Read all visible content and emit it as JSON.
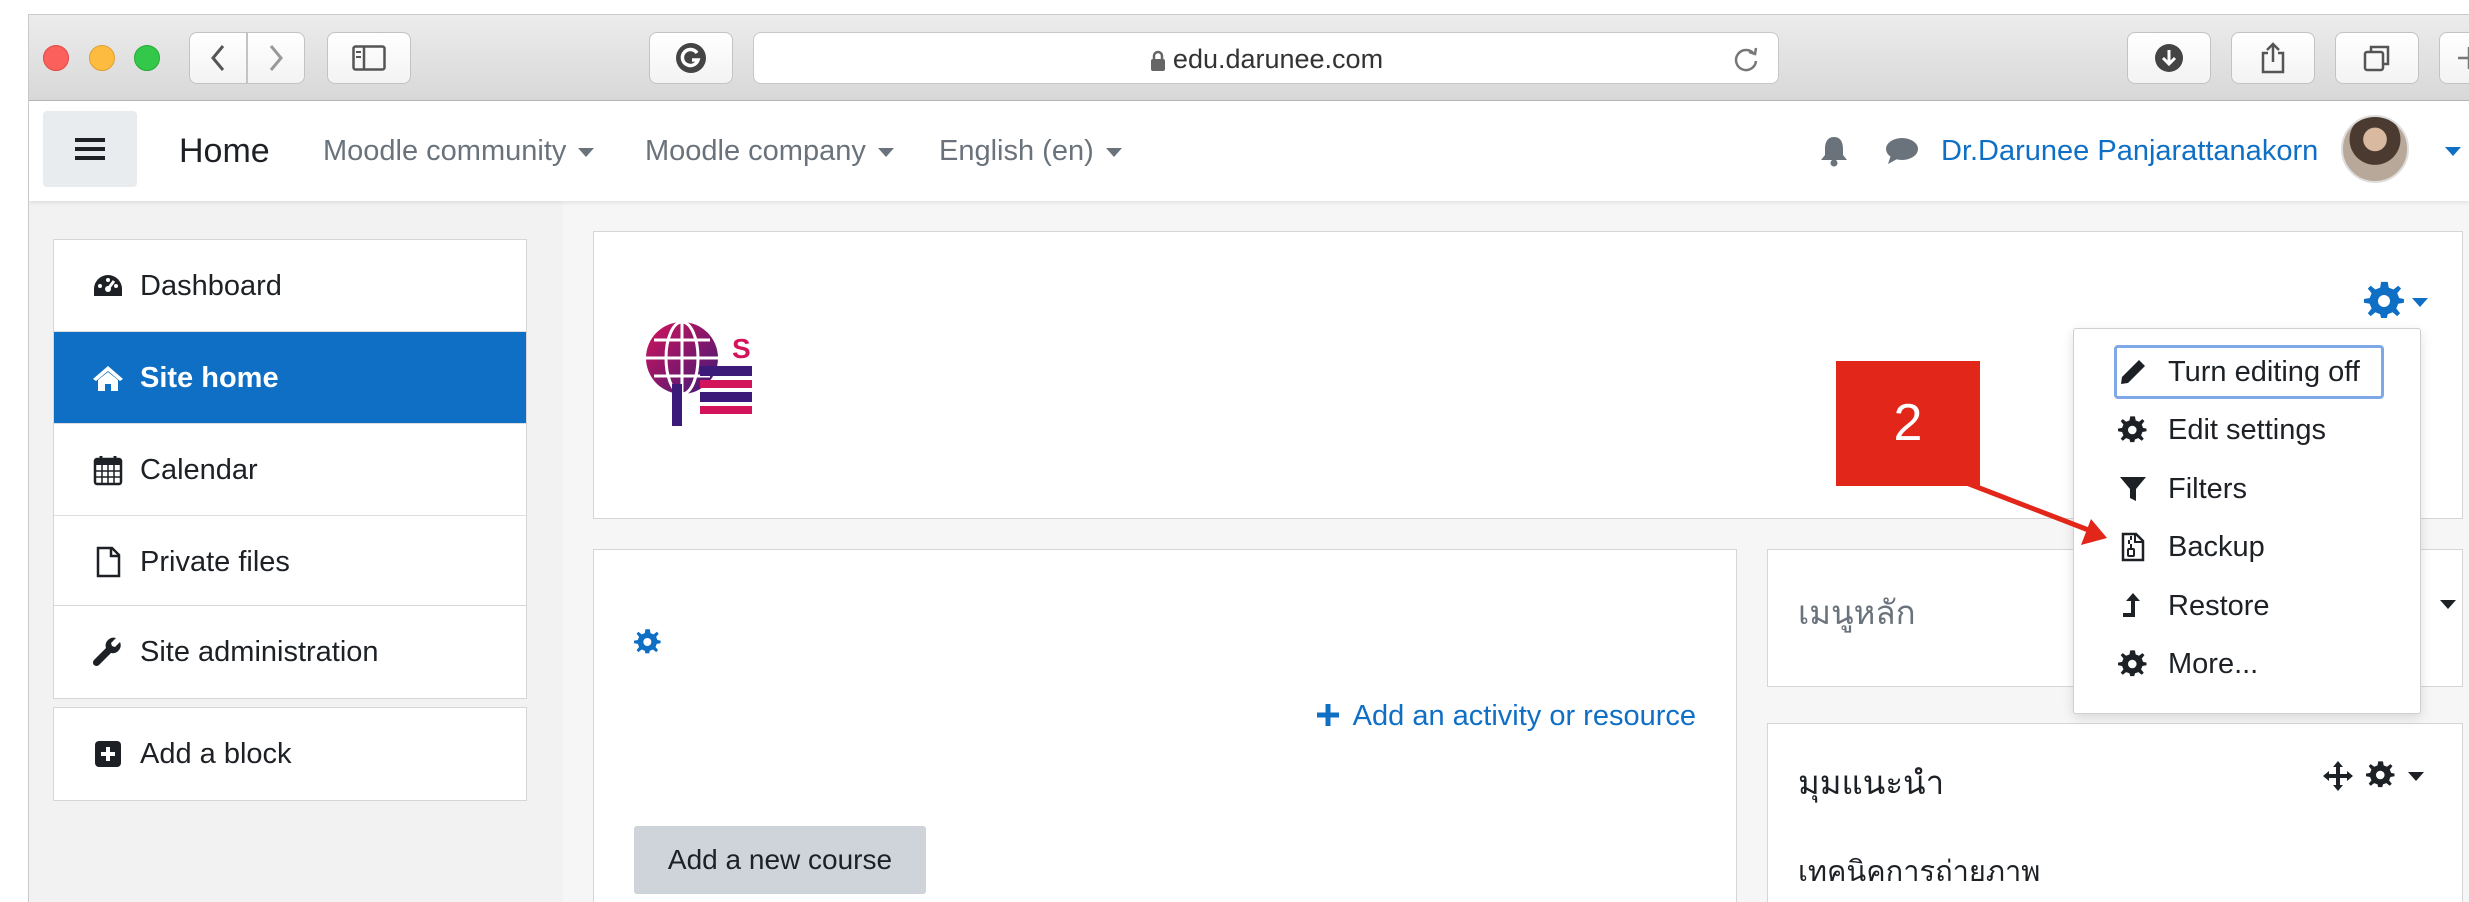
{
  "browser": {
    "url": "edu.darunee.com"
  },
  "navbar": {
    "home": "Home",
    "menus": [
      "Moodle community",
      "Moodle company",
      "English (en)"
    ],
    "user_name": "Dr.Darunee Panjarattanakorn"
  },
  "nav_drawer": {
    "items": [
      {
        "label": "Dashboard",
        "icon": "dashboard-icon"
      },
      {
        "label": "Site home",
        "icon": "home-icon",
        "active": true
      },
      {
        "label": "Calendar",
        "icon": "calendar-icon"
      },
      {
        "label": "Private files",
        "icon": "file-icon"
      }
    ],
    "admin": {
      "label": "Site administration",
      "icon": "wrench-icon"
    },
    "add_block": {
      "label": "Add a block",
      "icon": "plus-square-icon"
    }
  },
  "main": {
    "add_activity": "Add an activity or resource",
    "add_course": "Add a new course"
  },
  "blocks": {
    "main_menu_title": "เมนูหลัก",
    "recommend_title": "มุมแนะนำ",
    "recommend_item": "เทคนิคการถ่ายภาพ"
  },
  "settings_menu": {
    "items": [
      "Turn editing off",
      "Edit settings",
      "Filters",
      "Backup",
      "Restore",
      "More..."
    ]
  },
  "annotation": {
    "step": "2"
  },
  "colors": {
    "accent": "#0f6fc5",
    "annotation": "#e3261a"
  }
}
